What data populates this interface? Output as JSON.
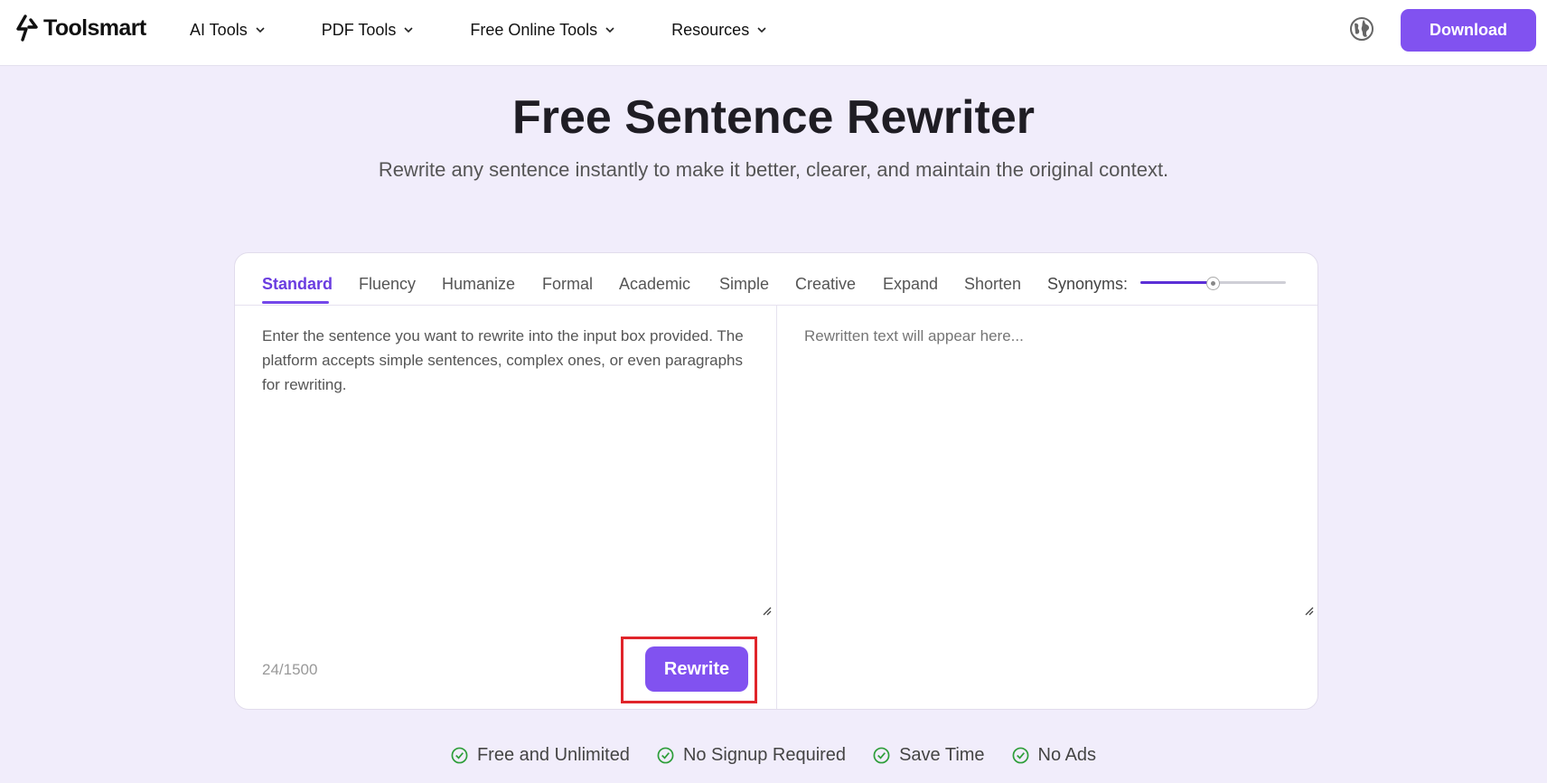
{
  "header": {
    "logo_text": "Toolsmart",
    "nav": [
      {
        "label": "AI Tools"
      },
      {
        "label": "PDF Tools"
      },
      {
        "label": "Free Online Tools"
      },
      {
        "label": "Resources"
      }
    ],
    "download_label": "Download"
  },
  "hero": {
    "title": "Free Sentence Rewriter",
    "subtitle": "Rewrite any sentence instantly to make it better, clearer, and maintain the original context."
  },
  "tool": {
    "modes": [
      "Standard",
      "Fluency",
      "Humanize",
      "Formal",
      "Academic",
      "Simple",
      "Creative",
      "Expand",
      "Shorten"
    ],
    "active_mode": "Standard",
    "synonyms_label": "Synonyms:",
    "synonyms_level": 0.5,
    "input_text": "Enter the sentence you want to rewrite into the input box provided. The platform accepts simple sentences, complex ones, or even paragraphs for rewriting.",
    "output_placeholder": "Rewritten text will appear here...",
    "counter": "24/1500",
    "rewrite_label": "Rewrite"
  },
  "features": [
    {
      "label": "Free and Unlimited"
    },
    {
      "label": "No Signup Required"
    },
    {
      "label": "Save Time"
    },
    {
      "label": "No Ads"
    }
  ],
  "colors": {
    "accent": "#8152f0",
    "active_tab": "#6a3de0",
    "highlight_frame": "#e0242a",
    "check_green": "#2e9e3a",
    "page_bg": "#f1edfb"
  }
}
